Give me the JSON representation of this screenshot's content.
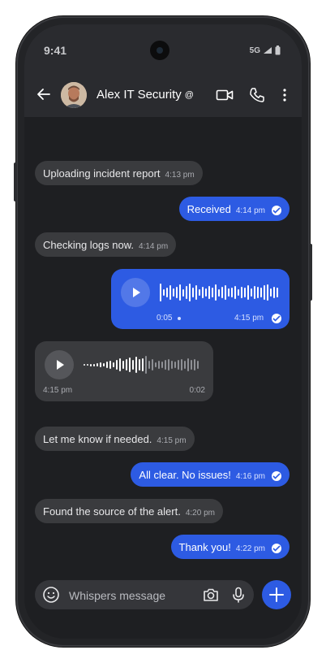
{
  "status": {
    "time": "9:41",
    "network": "5G"
  },
  "header": {
    "contact_name": "Alex IT Security",
    "verified_symbol": "@"
  },
  "messages": [
    {
      "direction": "in",
      "text": "Uploading incident report",
      "time": "4:13 pm"
    },
    {
      "direction": "out",
      "text": "Received",
      "time": "4:14 pm"
    },
    {
      "direction": "in",
      "text": "Checking logs now.",
      "time": "4:14 pm"
    },
    {
      "direction": "out",
      "type": "voice",
      "duration": "0:05",
      "time": "4:15 pm"
    },
    {
      "direction": "in",
      "type": "voice",
      "duration": "0:02",
      "time": "4:15 pm"
    },
    {
      "direction": "in",
      "text": "Let me know if needed.",
      "time": "4:15 pm"
    },
    {
      "direction": "out",
      "text": "All clear. No issues!",
      "time": "4:16 pm"
    },
    {
      "direction": "in",
      "text": "Found the source of the alert.",
      "time": "4:20 pm"
    },
    {
      "direction": "out",
      "text": "Thank you!",
      "time": "4:22 pm"
    }
  ],
  "composer": {
    "placeholder": "Whispers message"
  },
  "colors": {
    "accent": "#2d5be3",
    "incoming_bubble": "#3a3b3e",
    "background": "#1e1f22"
  }
}
